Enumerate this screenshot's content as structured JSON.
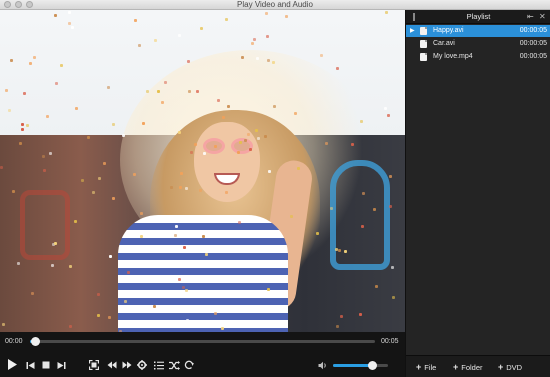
{
  "window": {
    "title": "Play Video and Audio"
  },
  "player": {
    "current_time": "00:00",
    "total_time": "00:05",
    "progress": 0.01,
    "volume": 0.7,
    "controls": [
      "play-icon",
      "skip-previous-icon",
      "stop-icon",
      "skip-next-icon",
      "fullscreen-icon",
      "rewind-icon",
      "fast-forward-icon",
      "settings-icon",
      "list-icon",
      "shuffle-icon",
      "repeat-icon",
      "volume-icon"
    ]
  },
  "playlist": {
    "title": "Playlist",
    "items": [
      {
        "name": "Happy.avi",
        "duration": "00:00:05",
        "active": true
      },
      {
        "name": "Car.avi",
        "duration": "00:00:05",
        "active": false
      },
      {
        "name": "My love.mp4",
        "duration": "00:00:05",
        "active": false
      }
    ],
    "footer": [
      {
        "label": "File"
      },
      {
        "label": "Folder"
      },
      {
        "label": "DVD"
      }
    ]
  },
  "colors": {
    "accent": "#2b90d9",
    "panel": "#242424",
    "controls_bg": "#141414"
  }
}
